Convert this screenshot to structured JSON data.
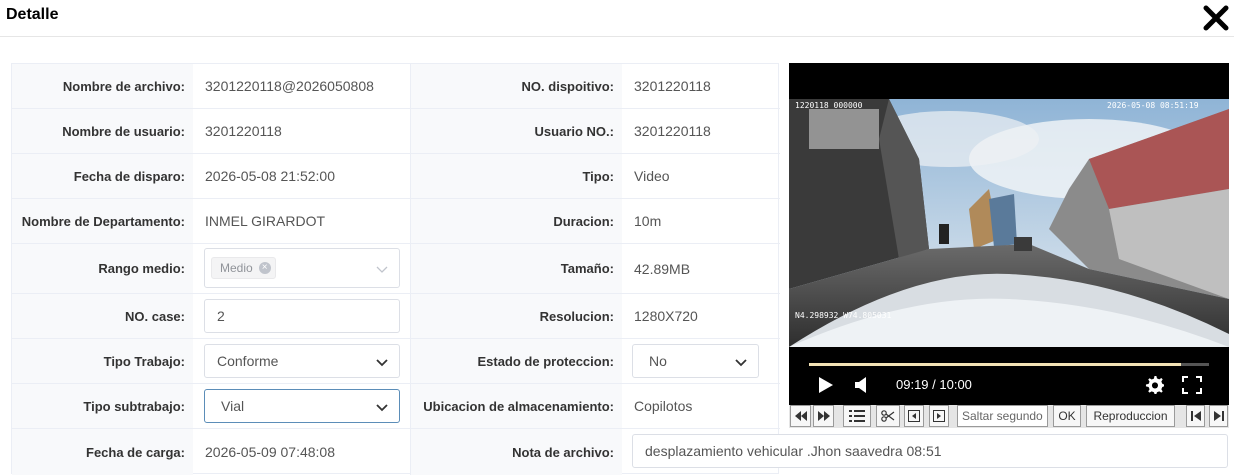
{
  "dialog": {
    "title": "Detalle",
    "close_icon": "close-icon"
  },
  "form": {
    "nombre_archivo": {
      "label": "Nombre de archivo:",
      "value": "3201220118@2026050808"
    },
    "no_dispositivo": {
      "label": "NO. dispoitivo:",
      "value": "3201220118"
    },
    "nombre_usuario": {
      "label": "Nombre de usuario:",
      "value": "3201220118"
    },
    "usuario_no": {
      "label": "Usuario NO.:",
      "value": "3201220118"
    },
    "fecha_disparo": {
      "label": "Fecha de disparo:",
      "value": "2026-05-08 21:52:00"
    },
    "tipo": {
      "label": "Tipo:",
      "value": "Video"
    },
    "nombre_departamento": {
      "label": "Nombre de Departamento:",
      "value": "INMEL GIRARDOT"
    },
    "duracion": {
      "label": "Duracion:",
      "value": "10m"
    },
    "rango_medio": {
      "label": "Rango medio:",
      "tag": "Medio"
    },
    "tamano": {
      "label": "Tamaño:",
      "value": "42.89MB"
    },
    "no_case": {
      "label": "NO. case:",
      "value": "2"
    },
    "resolucion": {
      "label": "Resolucion:",
      "value": "1280X720"
    },
    "tipo_trabajo": {
      "label": "Tipo Trabajo:",
      "value": "Conforme"
    },
    "estado_proteccion": {
      "label": "Estado de proteccion:",
      "value": "No"
    },
    "tipo_subtrabajo": {
      "label": "Tipo subtrabajo:",
      "value": "Vial"
    },
    "ubicacion": {
      "label": "Ubicacion de almacenamiento:",
      "value": "Copilotos"
    },
    "fecha_carga": {
      "label": "Fecha de carga:",
      "value": "2026-05-09 07:48:08"
    },
    "nota_archivo": {
      "label": "Nota de archivo:",
      "value": "desplazamiento vehicular .Jhon saavedra 08:51"
    }
  },
  "player": {
    "osd_device": "1220118 000000",
    "osd_datetime": "2026-05-08 08:51:19",
    "osd_coords": "N4.298932  W74.805031",
    "time_display": "09:19 / 10:00",
    "progress": 0.93,
    "icons": [
      "play-icon",
      "volume-icon",
      "gear-icon",
      "fullscreen-icon"
    ]
  },
  "toolbar": {
    "seek_placeholder": "Saltar segundo",
    "ok_label": "OK",
    "playback_label": "Reproduccion"
  },
  "colors": {
    "border": "#ebeef5",
    "label_bg": "#f8f9fb",
    "progress_fill": "#f3e3b5"
  }
}
